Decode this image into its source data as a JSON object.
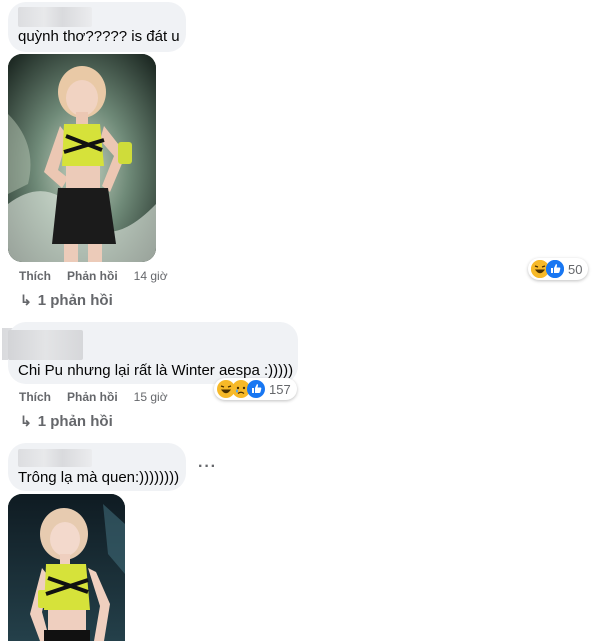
{
  "comments": [
    {
      "text": "quỳnh thơ????? is đát u",
      "actions": {
        "like": "Thích",
        "reply": "Phản hồi",
        "time": "14 giờ"
      },
      "reactions": {
        "icons": [
          "haha-icon",
          "like-icon"
        ],
        "count": "50"
      },
      "replies_link": "1 phản hồi",
      "has_photo": true
    },
    {
      "text": "Chi Pu nhưng lại rất là Winter aespa :)))))",
      "actions": {
        "like": "Thích",
        "reply": "Phản hồi",
        "time": "15 giờ"
      },
      "reactions": {
        "icons": [
          "haha-icon",
          "sad-icon",
          "like-icon"
        ],
        "count": "157"
      },
      "replies_link": "1 phản hồi",
      "has_photo": false
    },
    {
      "text": "Trông lạ mà quen:))))))))",
      "more_label": "···",
      "has_photo": true
    }
  ],
  "reply_arrow": "↳",
  "colors": {
    "bubble": "#f0f2f5",
    "secondary_text": "#65676b",
    "outfit_yellow": "#d6e23a",
    "like_blue": "#1877f2",
    "haha_yellow": "#f7b928"
  }
}
